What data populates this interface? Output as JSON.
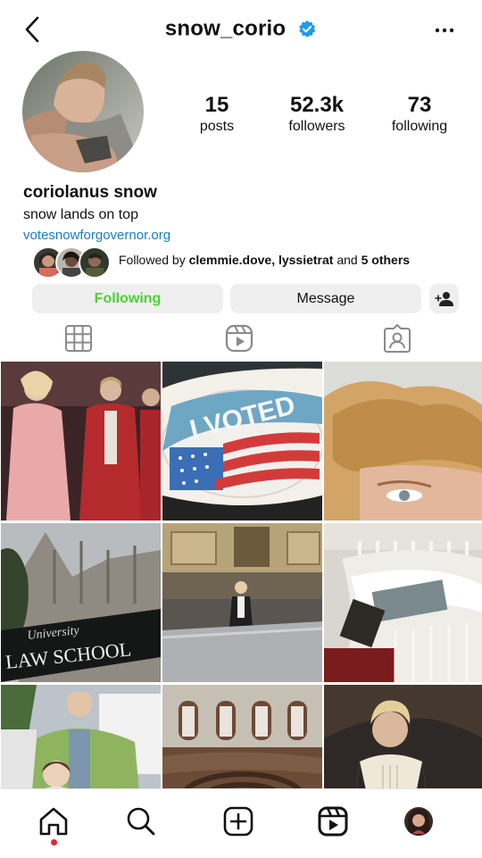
{
  "header": {
    "username": "snow_corio",
    "verified": true
  },
  "profile": {
    "posts_count": "15",
    "posts_label": "posts",
    "followers_count": "52.3k",
    "followers_label": "followers",
    "following_count": "73",
    "following_label": "following",
    "name": "coriolanus snow",
    "bio": "snow lands on top",
    "link": "votesnowforgovernor.org"
  },
  "followed_by": {
    "prefix": "Followed by ",
    "names": "clemmie.dove, lyssietrat",
    "and": " and ",
    "others": "5 others"
  },
  "actions": {
    "following_label": "Following",
    "message_label": "Message"
  },
  "grid_posts": [
    {
      "subject": "pink and red suits crowd"
    },
    {
      "subject": "I VOTED sticker",
      "sticker_text": "I VOTED"
    },
    {
      "subject": "blond hair close-up"
    },
    {
      "subject": "law school building",
      "sign_top": "University",
      "sign_main": "LAW SCHOOL"
    },
    {
      "subject": "man in ornate hall"
    },
    {
      "subject": "book on rotunda railing"
    },
    {
      "subject": "man and girl with trucks"
    },
    {
      "subject": "legislative chamber"
    },
    {
      "subject": "man in vest dark background"
    }
  ],
  "colors": {
    "accent_link": "#1a7cc2",
    "following_green": "#4cd137",
    "verified_blue": "#1d9bf0",
    "notification": "#e8222f"
  }
}
